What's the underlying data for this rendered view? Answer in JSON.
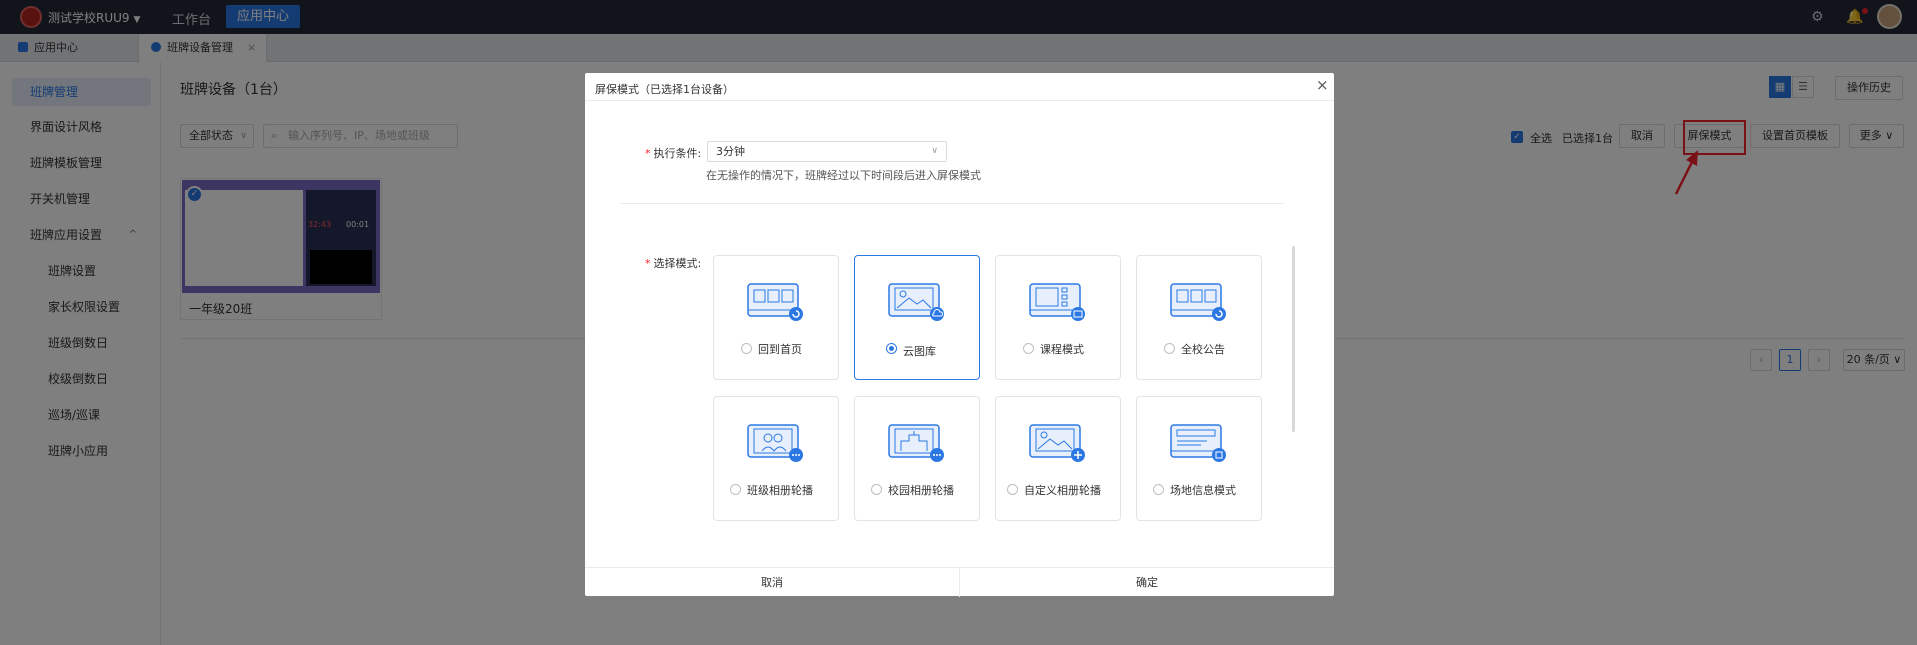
{
  "topbar": {
    "school": "测试学校RUU9",
    "nav": [
      "工作台",
      "应用中心"
    ]
  },
  "tabs": [
    {
      "label": "应用中心"
    },
    {
      "label": "班牌设备管理"
    }
  ],
  "sidebar": {
    "items": [
      {
        "label": "班牌管理"
      },
      {
        "label": "界面设计风格"
      },
      {
        "label": "班牌模板管理"
      },
      {
        "label": "开关机管理"
      },
      {
        "label": "班牌应用设置"
      },
      {
        "label": "班牌设置"
      },
      {
        "label": "家长权限设置"
      },
      {
        "label": "班级倒数日"
      },
      {
        "label": "校级倒数日"
      },
      {
        "label": "巡场/巡课"
      },
      {
        "label": "班牌小应用"
      }
    ]
  },
  "page": {
    "title": "班牌设备（1台）",
    "history_button": "操作历史",
    "status_filter": "全部状态",
    "search_placeholder": "输入序列号、IP、场地或班级",
    "select_all": "全选",
    "selected_count": "已选择1台",
    "cancel_button": "取消",
    "screensaver_button": "屏保模式",
    "home_template_button": "设置首页模板",
    "more_button": "更多",
    "device": {
      "name": "一年级20班",
      "time": "32:43",
      "time2": "00:01"
    },
    "pagination": {
      "page": "1",
      "size": "20 条/页"
    }
  },
  "modal": {
    "title": "屏保模式（已选择1台设备）",
    "condition_label": "执行条件:",
    "condition_value": "3分钟",
    "condition_hint": "在无操作的情况下，班牌经过以下时间段后进入屏保模式",
    "mode_label": "选择模式:",
    "options": [
      {
        "label": "回到首页",
        "badge": "return"
      },
      {
        "label": "云图库",
        "badge": "cloud"
      },
      {
        "label": "课程模式",
        "badge": "book"
      },
      {
        "label": "全校公告",
        "badge": "return"
      },
      {
        "label": "班级相册轮播",
        "badge": "more"
      },
      {
        "label": "校园相册轮播",
        "badge": "more"
      },
      {
        "label": "自定义相册轮播",
        "badge": "plus"
      },
      {
        "label": "场地信息模式",
        "badge": "square"
      }
    ],
    "selected_option": "云图库",
    "cancel": "取消",
    "confirm": "确定"
  },
  "colors": {
    "accent": "#2b78e4",
    "highlight": "#f5222d",
    "topbar": "#222a36"
  }
}
